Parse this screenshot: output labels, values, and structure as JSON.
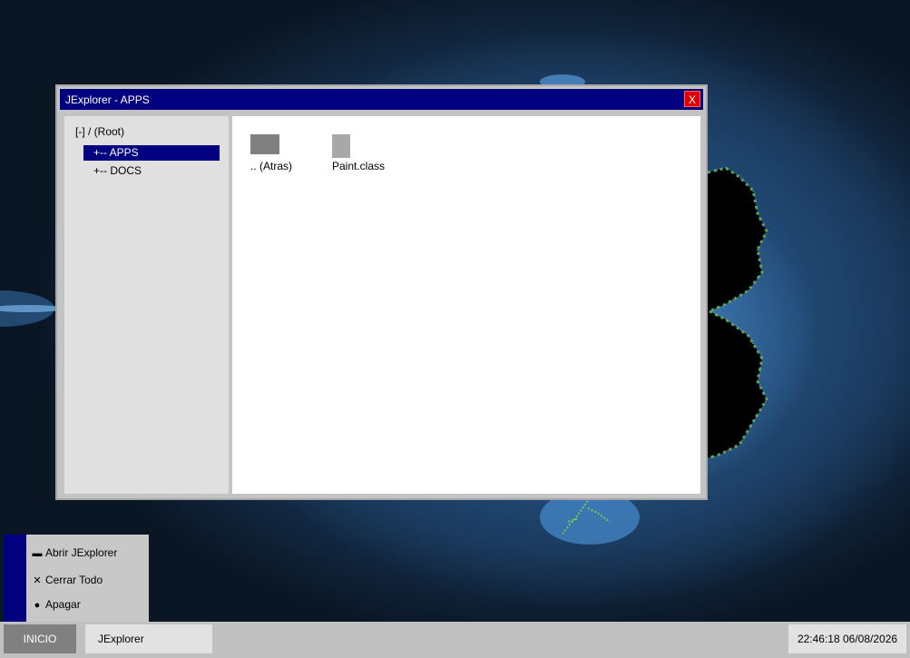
{
  "window": {
    "title": "JExplorer - APPS",
    "close_label": "X",
    "tree": {
      "root_label": "[-] / (Root)",
      "items": [
        {
          "label": "+-- APPS",
          "selected": true
        },
        {
          "label": "+-- DOCS",
          "selected": false
        }
      ]
    },
    "files": [
      {
        "label": ".. (Atras)",
        "icon": "folder-icon",
        "color": "#808080"
      },
      {
        "label": "Paint.class",
        "icon": "file-icon",
        "color": "#a8a8a8"
      }
    ]
  },
  "start_menu": {
    "items": [
      {
        "label": "Abrir JExplorer",
        "icon": "folder-icon",
        "glyph": "▬"
      },
      {
        "label": "Cerrar Todo",
        "icon": "close-icon",
        "glyph": "✕"
      },
      {
        "label": "Apagar",
        "icon": "lightbulb-icon",
        "glyph": "●"
      }
    ]
  },
  "taskbar": {
    "start_label": "INICIO",
    "tasks": [
      {
        "label": "JExplorer"
      }
    ],
    "clock": "22:46:18  06/08/2026"
  },
  "colors": {
    "titlebar": "#000080",
    "selection": "#000080",
    "close_button": "#e00000",
    "desktop": "#0a1624"
  }
}
